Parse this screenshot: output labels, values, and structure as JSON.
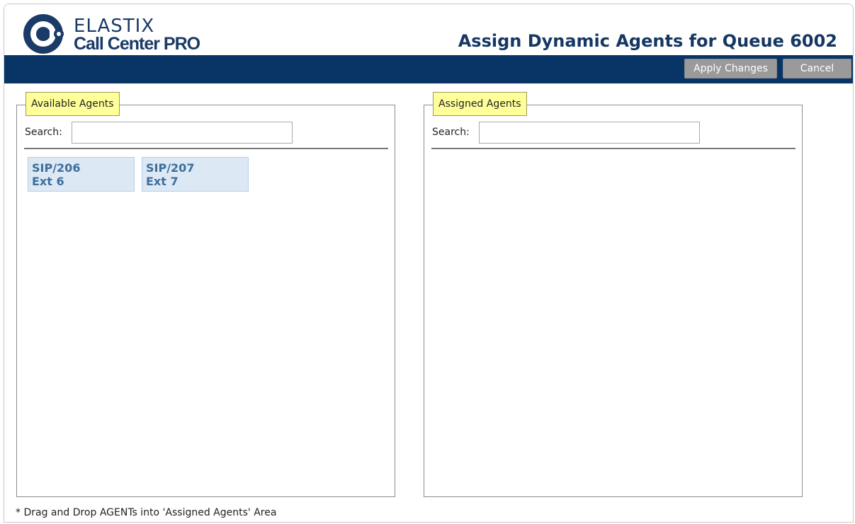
{
  "branding": {
    "logo_top": "ELASTIX",
    "logo_bottom": "Call Center PRO"
  },
  "header": {
    "title": "Assign Dynamic Agents for Queue 6002"
  },
  "toolbar": {
    "apply_label": "Apply Changes",
    "cancel_label": "Cancel"
  },
  "available": {
    "legend": "Available Agents",
    "search_label": "Search:",
    "search_value": "",
    "agents": [
      {
        "channel": "SIP/206",
        "ext": "Ext 6"
      },
      {
        "channel": "SIP/207",
        "ext": "Ext 7"
      }
    ]
  },
  "assigned": {
    "legend": "Assigned Agents",
    "search_label": "Search:",
    "search_value": "",
    "agents": []
  },
  "footnote": "* Drag and Drop AGENTs into 'Assigned Agents' Area",
  "colors": {
    "brand_navy": "#083565",
    "title_text": "#163764",
    "legend_bg": "#ffff99",
    "agent_bg": "#dce8f4",
    "agent_text": "#3f6e9c",
    "button_bg": "#9a9a9a"
  }
}
